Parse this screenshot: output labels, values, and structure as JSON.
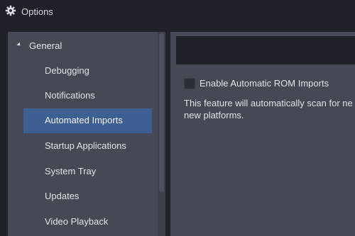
{
  "window": {
    "title": "Options",
    "icon": "gear-icon"
  },
  "sidebar": {
    "group_label": "General",
    "items": [
      {
        "label": "Debugging",
        "selected": false
      },
      {
        "label": "Notifications",
        "selected": false
      },
      {
        "label": "Automated Imports",
        "selected": true
      },
      {
        "label": "Startup Applications",
        "selected": false
      },
      {
        "label": "System Tray",
        "selected": false
      },
      {
        "label": "Updates",
        "selected": false
      },
      {
        "label": "Video Playback",
        "selected": false
      }
    ]
  },
  "content": {
    "checkbox_label": "Enable Automatic ROM Imports",
    "checkbox_checked": false,
    "description_line1": "This feature will automatically scan for ne",
    "description_line2": "new platforms."
  },
  "colors": {
    "selected_item": "#3e5f92",
    "panel_bg": "#454955",
    "window_bg": "#1f2229"
  }
}
